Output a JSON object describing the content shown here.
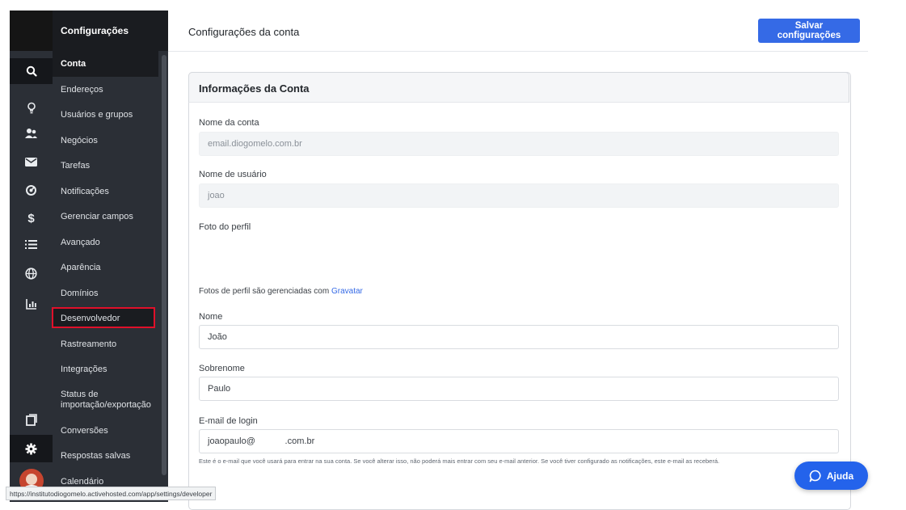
{
  "app": {
    "menu_title": "Configurações",
    "page_title": "Configurações da conta",
    "save_label": "Salvar configurações"
  },
  "rail": {
    "icons": [
      "search-icon",
      "lightbulb-icon",
      "contacts-icon",
      "mail-icon",
      "automation-icon",
      "dollar-icon",
      "list-icon",
      "globe-icon",
      "reports-icon",
      "pages-icon",
      "gear-icon",
      "avatar"
    ],
    "colors": {
      "background": "#2b2f36",
      "active": "#15171b"
    }
  },
  "menu": {
    "items": [
      {
        "label": "Conta",
        "active": true
      },
      {
        "label": "Endereços"
      },
      {
        "label": "Usuários e grupos"
      },
      {
        "label": "Negócios"
      },
      {
        "label": "Tarefas"
      },
      {
        "label": "Notificações"
      },
      {
        "label": "Gerenciar campos"
      },
      {
        "label": "Avançado"
      },
      {
        "label": "Aparência"
      },
      {
        "label": "Domínios"
      },
      {
        "label": "Desenvolvedor",
        "highlighted": true
      },
      {
        "label": "Rastreamento"
      },
      {
        "label": "Integrações"
      },
      {
        "label": "Status de importação/exportação"
      },
      {
        "label": "Conversões"
      },
      {
        "label": "Respostas salvas"
      },
      {
        "label": "Calendário"
      }
    ],
    "highlight_color": "#e0102a"
  },
  "card": {
    "title": "Informações da Conta",
    "account_name_label": "Nome da conta",
    "account_name_value": "email.diogomelo.com.br",
    "username_label": "Nome de usuário",
    "username_value": "joao",
    "photo_label": "Foto do perfil",
    "gravatar_text": "Fotos de perfil são gerenciadas com",
    "gravatar_link": "Gravatar",
    "first_name_label": "Nome",
    "first_name_value": "João",
    "last_name_label": "Sobrenome",
    "last_name_value": "Paulo",
    "login_email_label": "E-mail de login",
    "login_email_value": "joaopaulo@            .com.br",
    "login_email_help": "Este é o e-mail que você usará para entrar na sua conta. Se você alterar isso, não poderá mais entrar com seu e-mail anterior. Se você tiver configurado as notificações, este e-mail as receberá."
  },
  "help_button": {
    "label": "Ajuda"
  },
  "status_bar": {
    "url": "https://institutodiogomelo.activehosted.com/app/settings/developer"
  },
  "colors": {
    "accent": "#356ae6",
    "help": "#2463eb",
    "sidebar": "#2b2f36"
  }
}
